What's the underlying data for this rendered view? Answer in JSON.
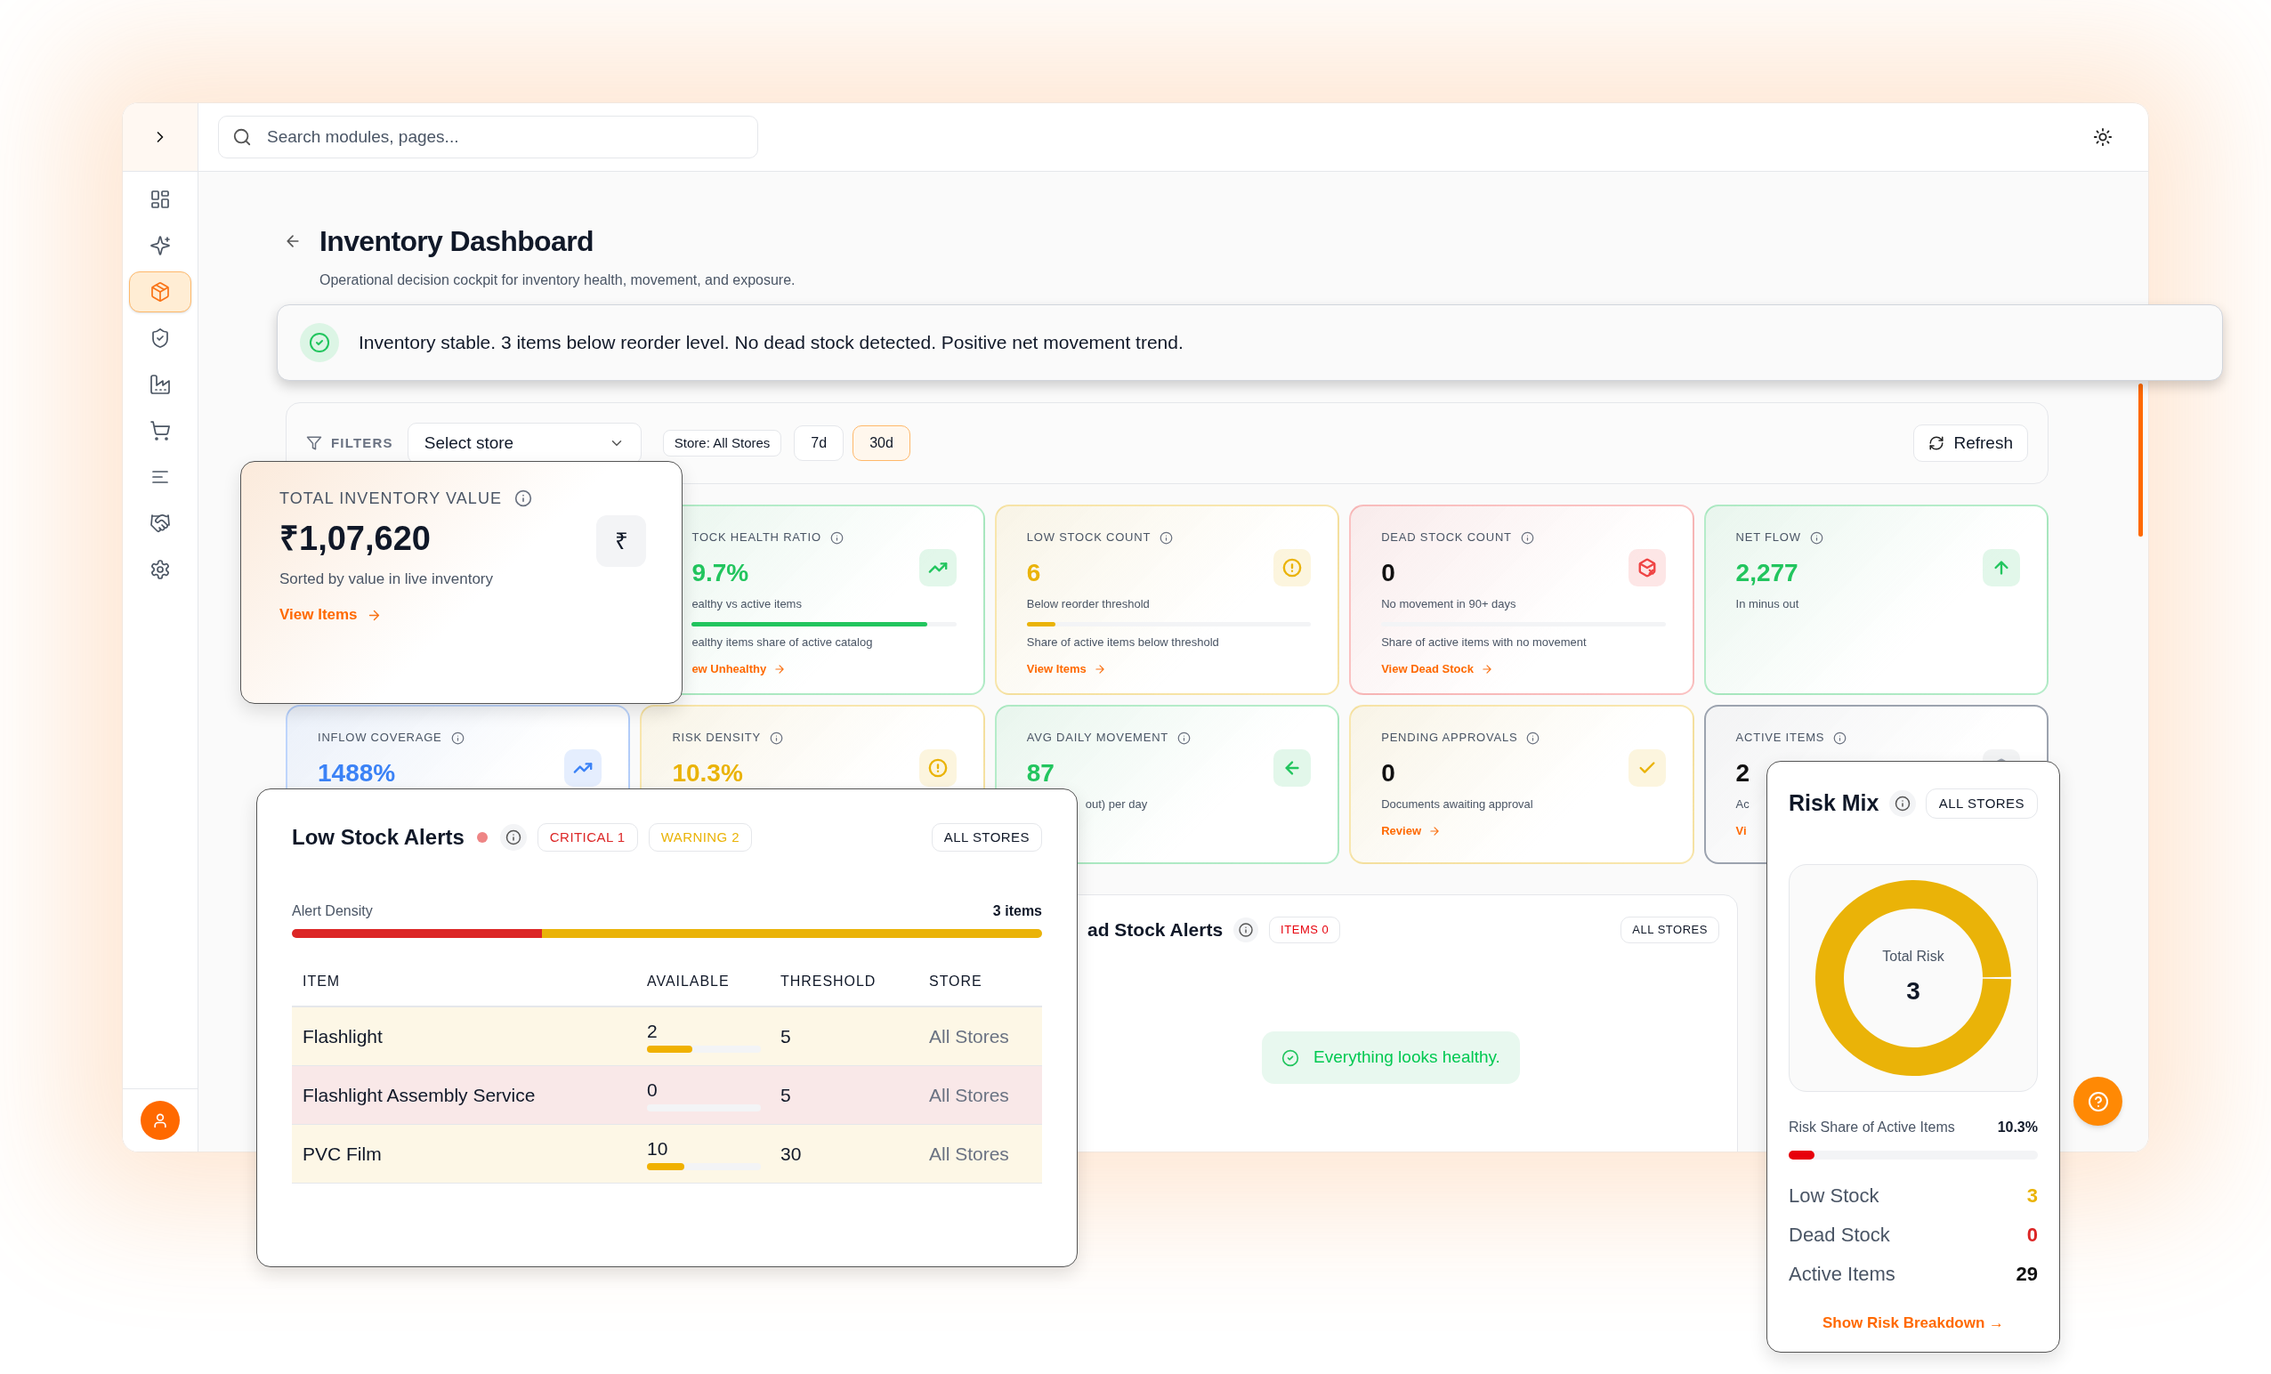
{
  "header": {
    "search": {
      "placeholder": "Search modules, pages..."
    }
  },
  "sidebar": {
    "items": [
      {
        "kind": "dashboard",
        "selected": false
      },
      {
        "kind": "ai",
        "selected": false
      },
      {
        "kind": "inventory",
        "selected": true
      },
      {
        "kind": "security",
        "selected": false
      },
      {
        "kind": "factory",
        "selected": false
      },
      {
        "kind": "cart",
        "selected": false
      },
      {
        "kind": "list",
        "selected": false
      },
      {
        "kind": "partners",
        "selected": false
      },
      {
        "kind": "settings",
        "selected": false
      }
    ]
  },
  "page": {
    "title": "Inventory Dashboard",
    "subtitle": "Operational decision cockpit for inventory health, movement, and exposure."
  },
  "banner": {
    "text": "Inventory stable. 3 items below reorder level. No dead stock detected. Positive net movement trend."
  },
  "filters": {
    "label": "FILTERS",
    "store_select": {
      "value": "Select store"
    },
    "chips": [
      "Store: All Stores"
    ],
    "ranges": [
      {
        "label": "7d",
        "selected": false
      },
      {
        "label": "30d",
        "selected": true
      }
    ],
    "refresh": "Refresh"
  },
  "summary_card": {
    "title": "TOTAL INVENTORY VALUE",
    "value": "₹1,07,620",
    "symbol": "₹",
    "subtitle": "Sorted by value in live inventory",
    "link": "View Items"
  },
  "kpi_rows": [
    [
      {
        "kind": "health",
        "color": "#22c55e",
        "accent_value": true,
        "cut_left": true,
        "title": "TOCK HEALTH RATIO",
        "value": "9.7%",
        "subtitle": "ealthy vs active items",
        "level": 0.89,
        "note": "ealthy items share of active catalog",
        "link": "ew Unhealthy"
      },
      {
        "kind": "low_stock",
        "color": "#eab308",
        "accent_value": true,
        "title": "LOW STOCK COUNT",
        "value": "6",
        "subtitle": "Below reorder threshold",
        "level": 0.1,
        "note": "Share of active items below threshold",
        "link": "View Items"
      },
      {
        "kind": "dead_stock",
        "color": "#ef4444",
        "accent_value": false,
        "title": "DEAD STOCK COUNT",
        "value": "0",
        "subtitle": "No movement in 90+ days",
        "level": 0,
        "note": "Share of active items with no movement",
        "link": "View Dead Stock"
      },
      {
        "kind": "net_flow",
        "color": "#22c55e",
        "accent_value": true,
        "title": "NET FLOW",
        "value": "2,277",
        "subtitle": "In minus out"
      }
    ],
    [
      {
        "kind": "inflow",
        "color": "#3b82f6",
        "accent_value": true,
        "title": "INFLOW COVERAGE",
        "value": "1488%"
      },
      {
        "kind": "risk",
        "color": "#eab308",
        "accent_value": true,
        "title": "RISK DENSITY",
        "value": "10.3%"
      },
      {
        "kind": "movement",
        "color": "#22c55e",
        "accent_value": true,
        "cut_left": true,
        "title": "AVG DAILY MOVEMENT",
        "value": "87",
        "subtitle": "out) per day"
      },
      {
        "kind": "approvals",
        "color": "#eab308",
        "accent_value": false,
        "title": "PENDING APPROVALS",
        "value": "0",
        "subtitle": "Documents awaiting approval",
        "link": "Review"
      },
      {
        "kind": "active",
        "color": "#9ca3af",
        "accent_value": false,
        "cut_right": true,
        "title": "ACTIVE ITEMS",
        "value": "2",
        "subtitle": "Ac",
        "link": "Vi"
      }
    ]
  ],
  "low_stock_alerts": {
    "title": "Low Stock Alerts",
    "status_dot": {
      "color": "#ee8585"
    },
    "badges": [
      {
        "label": "CRITICAL 1",
        "color": "#dc2626"
      },
      {
        "label": "WARNING 2",
        "color": "#eab308"
      }
    ],
    "scope": "ALL STORES",
    "density": {
      "label": "Alert Density",
      "count": "3 items",
      "segments": [
        {
          "color": "#dc2626",
          "level": 0.333
        },
        {
          "color": "#eab308",
          "level": 0.667
        }
      ]
    },
    "columns": [
      "ITEM",
      "AVAILABLE",
      "THRESHOLD",
      "STORE"
    ],
    "rows": [
      {
        "color": "#fdf7e6",
        "item": "Flashlight",
        "available": "2",
        "level": 0.4,
        "threshold": "5",
        "store": "All Stores"
      },
      {
        "color": "#f9e8e8",
        "item": "Flashlight Assembly Service",
        "available": "0",
        "level": 0,
        "threshold": "5",
        "store": "All Stores"
      },
      {
        "color": "#fdf7e6",
        "item": "PVC Film",
        "available": "10",
        "level": 0.33,
        "threshold": "30",
        "store": "All Stores"
      }
    ]
  },
  "dead_stock_alerts": {
    "title": "ad Stock Alerts",
    "cut_left": true,
    "badge": "ITEMS 0",
    "scope": "ALL STORES",
    "empty_message": "Everything looks healthy."
  },
  "risk_mix": {
    "title": "Risk Mix",
    "scope": "ALL STORES",
    "center_label": "Total Risk",
    "center_value": "3",
    "share": {
      "label": "Risk Share of Active Items",
      "value": "10.3%",
      "level": 0.103
    },
    "stats": [
      {
        "label": "Low Stock",
        "value": "3",
        "color": "#eab308"
      },
      {
        "label": "Dead Stock",
        "value": "0",
        "color": "#dc2626"
      },
      {
        "label": "Active Items",
        "value": "29",
        "color": "#111111"
      }
    ],
    "link": "Show Risk Breakdown →"
  }
}
